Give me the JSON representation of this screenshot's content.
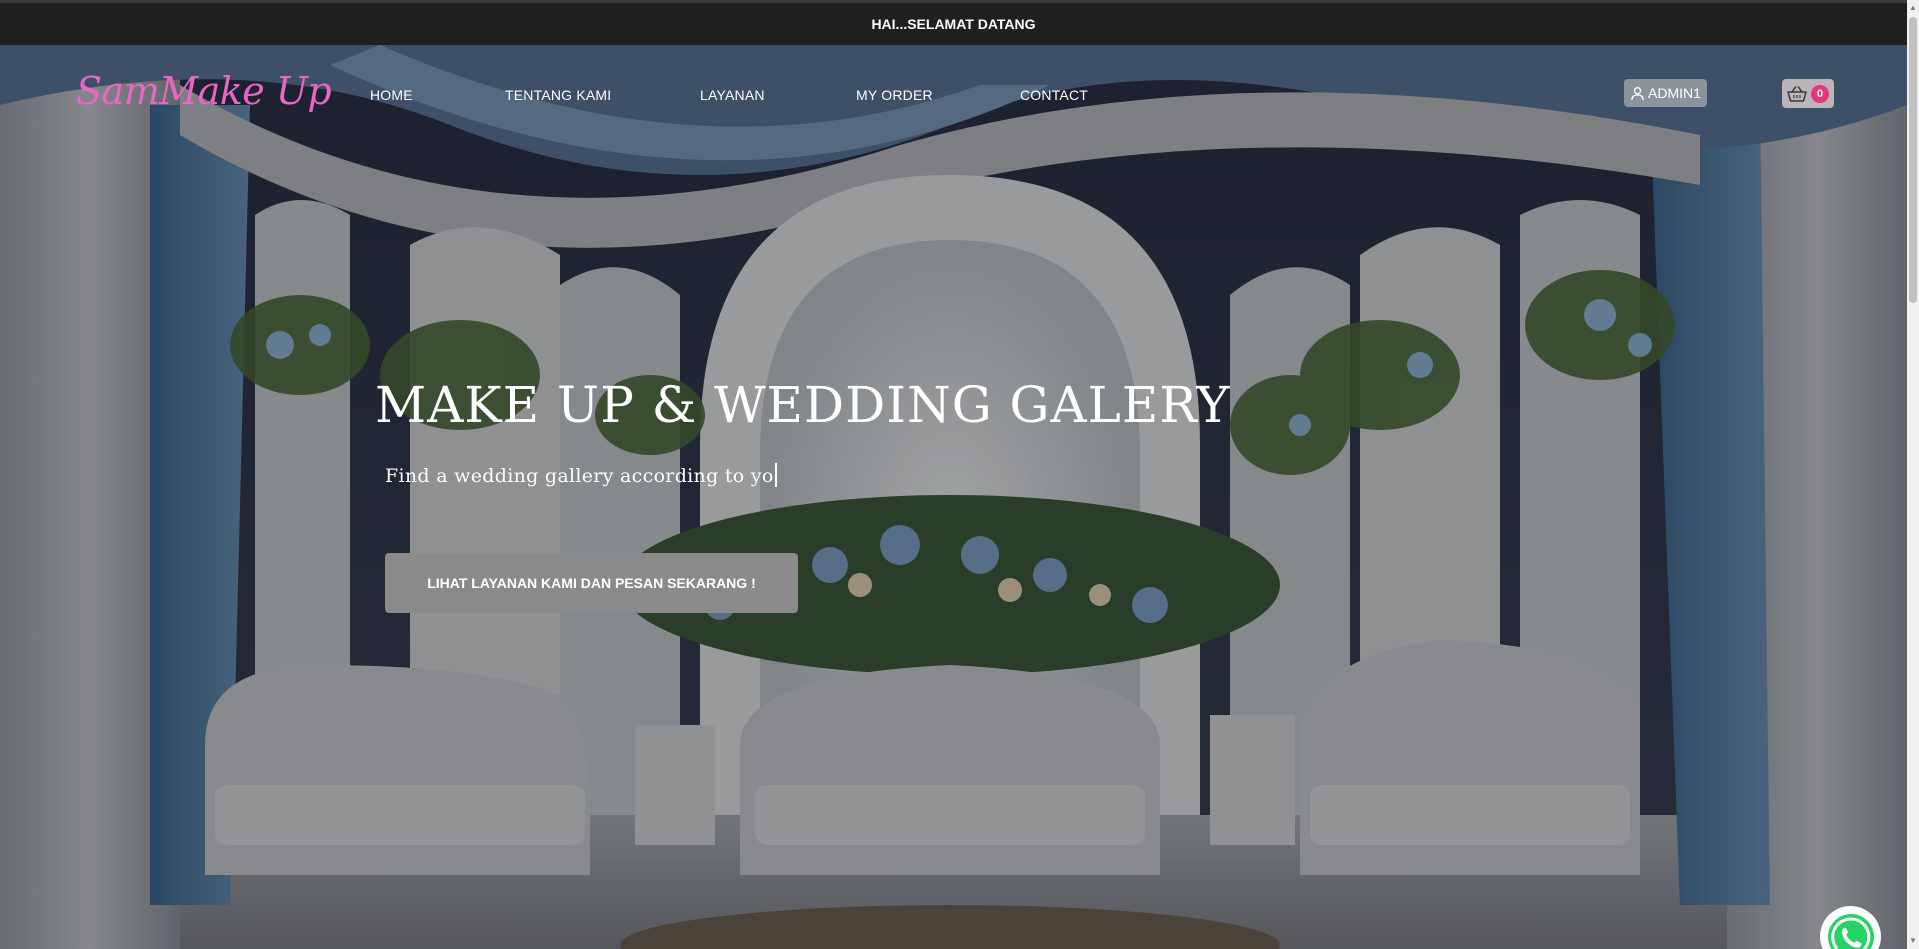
{
  "announcement": "HAI...SELAMAT DATANG",
  "brand": {
    "logo_text": "SamMake Up",
    "logo_color": "#e866c4"
  },
  "nav": {
    "items": [
      "HOME",
      "TENTANG KAMI",
      "LAYANAN",
      "MY ORDER",
      "CONTACT"
    ]
  },
  "user": {
    "name": "ADMIN1",
    "icon": "user-icon"
  },
  "cart": {
    "count": "0",
    "icon": "basket-icon",
    "badge_color": "#e8357c"
  },
  "hero": {
    "title": "MAKE UP & WEDDING GALERY",
    "subtitle": "Find a wedding gallery according to yo",
    "cta_label": "LIHAT LAYANAN KAMI DAN PESAN SEKARANG !",
    "background": "wedding-stage-photo"
  },
  "floating": {
    "whatsapp_icon": "whatsapp-icon",
    "color": "#25d366"
  }
}
